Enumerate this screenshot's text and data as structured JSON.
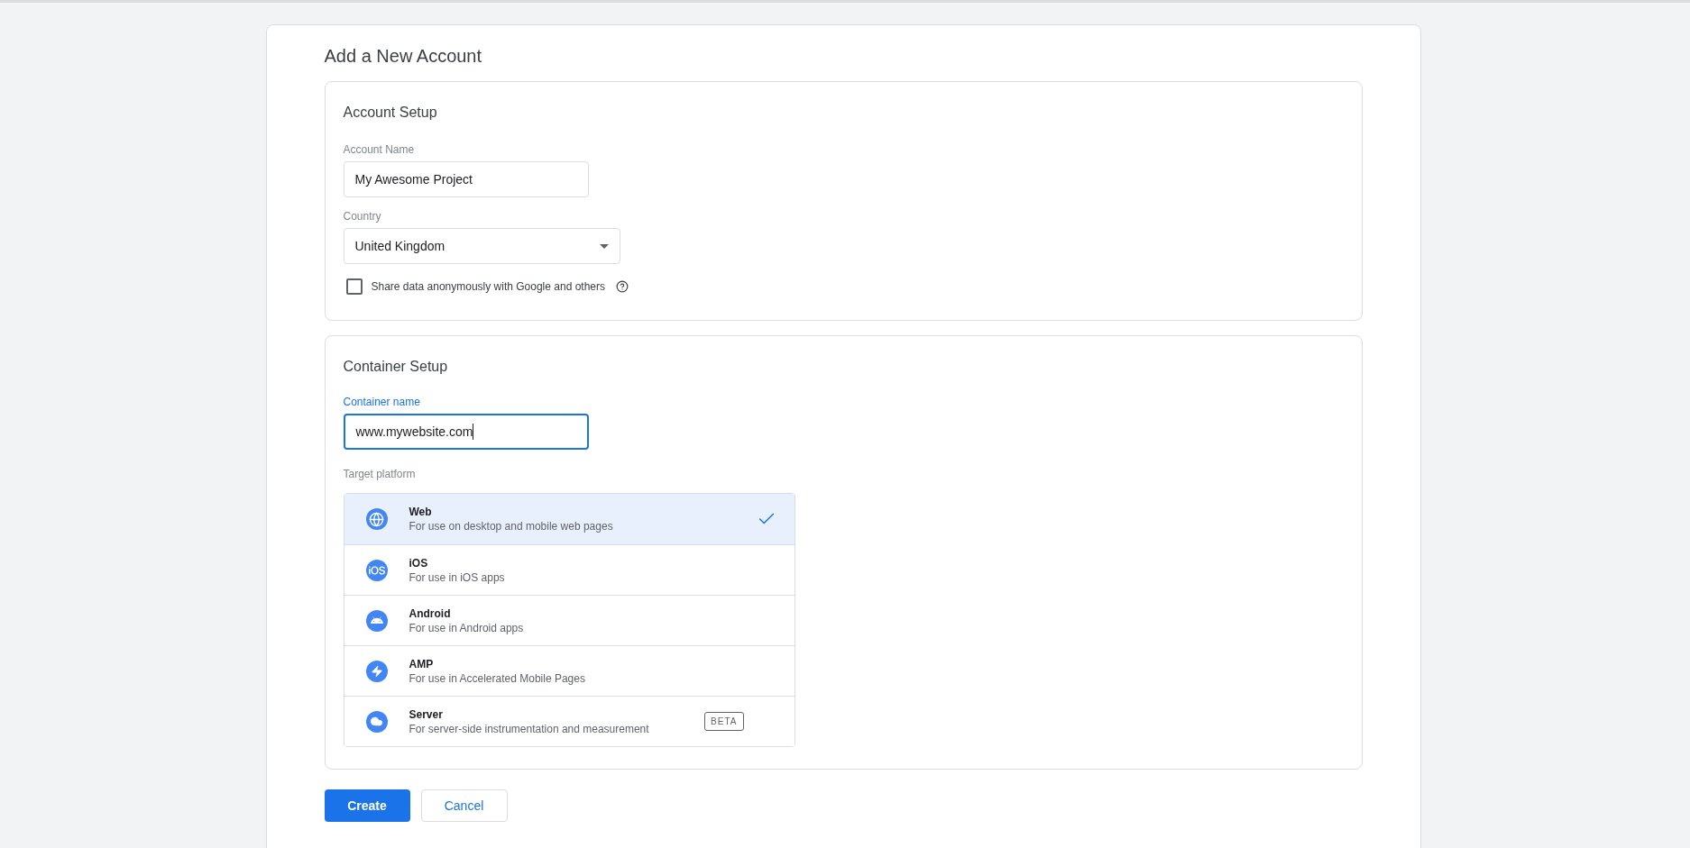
{
  "title": "Add a New Account",
  "account_setup": {
    "heading": "Account Setup",
    "account_name": {
      "label": "Account Name",
      "value": "My Awesome Project"
    },
    "country": {
      "label": "Country",
      "value": "United Kingdom"
    },
    "share_data": {
      "label": "Share data anonymously with Google and others",
      "checked": false
    }
  },
  "container_setup": {
    "heading": "Container Setup",
    "container_name": {
      "label": "Container name",
      "value": "www.mywebsite.com",
      "focused": true
    },
    "target_platform": {
      "label": "Target platform",
      "options": [
        {
          "kind": "web",
          "name": "Web",
          "description": "For use on desktop and mobile web pages",
          "selected": true
        },
        {
          "kind": "ios",
          "name": "iOS",
          "description": "For use in iOS apps",
          "selected": false
        },
        {
          "kind": "android",
          "name": "Android",
          "description": "For use in Android apps",
          "selected": false
        },
        {
          "kind": "amp",
          "name": "AMP",
          "description": "For use in Accelerated Mobile Pages",
          "selected": false
        },
        {
          "kind": "server",
          "name": "Server",
          "description": "For server-side instrumentation and measurement",
          "selected": false,
          "badge": "BETA"
        }
      ]
    }
  },
  "buttons": {
    "create": "Create",
    "cancel": "Cancel"
  }
}
